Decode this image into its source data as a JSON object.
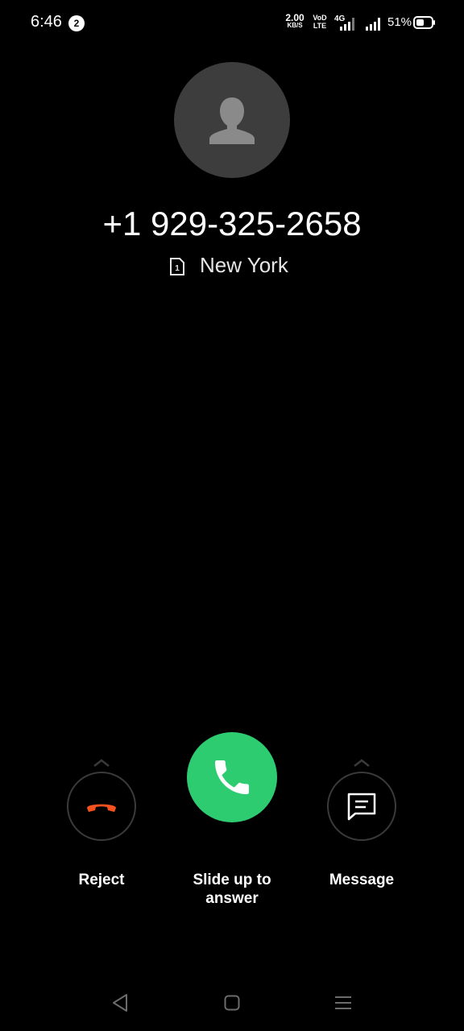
{
  "status_bar": {
    "time": "6:46",
    "notification_count": "2",
    "net_speed_value": "2.00",
    "net_speed_unit": "KB/S",
    "volte_top": "VoD",
    "volte_bottom": "LTE",
    "network_type": "4G",
    "battery_percent": "51%"
  },
  "caller": {
    "number": "+1 929-325-2658",
    "sim_slot": "1",
    "location": "New York"
  },
  "actions": {
    "reject_label": "Reject",
    "answer_label_line1": "Slide up to",
    "answer_label_line2": "answer",
    "message_label": "Message"
  },
  "colors": {
    "answer": "#2ecc71",
    "reject": "#f4511e",
    "background": "#000000"
  }
}
